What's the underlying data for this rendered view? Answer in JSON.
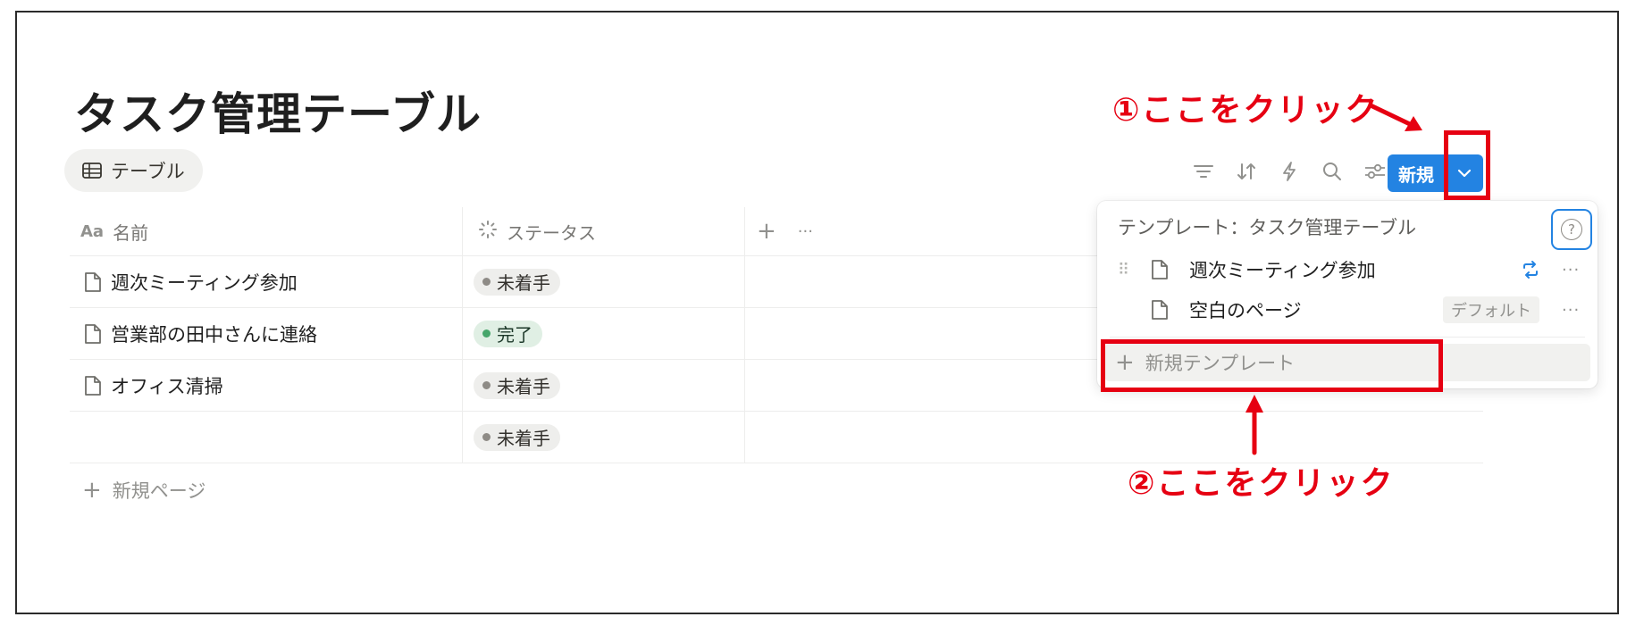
{
  "page": {
    "title": "タスク管理テーブル"
  },
  "view_tab": {
    "icon": "table-icon",
    "label": "テーブル"
  },
  "toolbar": {
    "icons": [
      "filter-icon",
      "sort-icon",
      "automation-icon",
      "search-icon",
      "settings-icon"
    ],
    "new_button_label": "新規",
    "dropdown_icon": "chevron-down-icon"
  },
  "table": {
    "columns": [
      {
        "icon": "text-property-icon",
        "icon_text": "Aa",
        "label": "名前"
      },
      {
        "icon": "status-property-icon",
        "label": "ステータス"
      }
    ],
    "add_column_label": "+",
    "more_label": "···",
    "rows": [
      {
        "name": "週次ミーティング参加",
        "status": "未着手"
      },
      {
        "name": "営業部の田中さんに連絡",
        "status": "完了"
      },
      {
        "name": "オフィス清掃",
        "status": "未着手"
      },
      {
        "name": "",
        "status": "未着手"
      }
    ],
    "add_page_label": "新規ページ"
  },
  "dropdown": {
    "title": "テンプレート：タスク管理テーブル",
    "help_label": "?",
    "templates": [
      {
        "label": "週次ミーティング参加",
        "icon": "repeat-icon",
        "more": "···"
      },
      {
        "label": "空白のページ",
        "badge": "デフォルト",
        "more": "···"
      }
    ],
    "new_template_label": "新規テンプレート"
  },
  "annotations": {
    "step1": "①ここをクリック",
    "step2": "②ここをクリック",
    "color": "#e60012"
  },
  "colors": {
    "accent": "#2383e2",
    "status_done": "#46a66b",
    "status_todo": "#8e8b86"
  }
}
